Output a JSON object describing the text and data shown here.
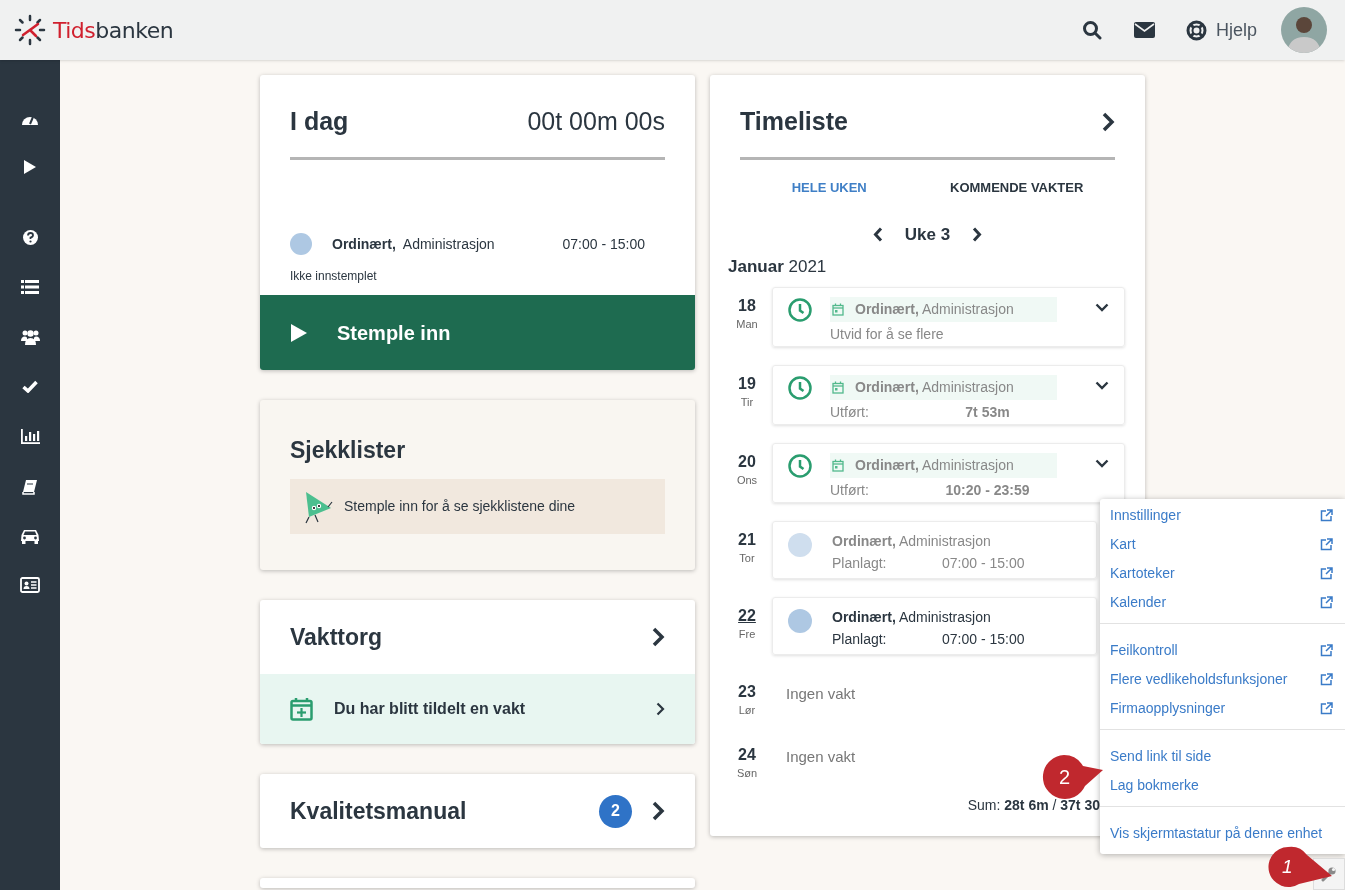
{
  "header": {
    "logo_prefix": "Tids",
    "logo_suffix": "banken",
    "help": "Hjelp"
  },
  "today": {
    "title": "I dag",
    "timer": "00t 00m 00s",
    "shift": {
      "type": "Ordinært,",
      "dept": "Administrasjon",
      "time": "07:00 - 15:00"
    },
    "status": "Ikke innstemplet",
    "button": "Stemple inn"
  },
  "checklists": {
    "title": "Sjekklister",
    "message": "Stemple inn for å se sjekklistene dine"
  },
  "shift_market": {
    "title": "Vakttorg",
    "notice": "Du har blitt tildelt en vakt"
  },
  "quality_manual": {
    "title": "Kvalitetsmanual",
    "badge": "2"
  },
  "timesheet": {
    "title": "Timeliste",
    "tabs": [
      {
        "label": "HELE UKEN",
        "selected": true
      },
      {
        "label": "KOMMENDE VAKTER",
        "selected": false
      }
    ],
    "week": "Uke 3",
    "month": "Januar",
    "year": "2021",
    "days": [
      {
        "date": "18",
        "weekday": "Man",
        "today": false,
        "entry": {
          "kind": "logged",
          "type": "Ordinært,",
          "dept": "Administrasjon",
          "note": "Utvid for å se flere"
        }
      },
      {
        "date": "19",
        "weekday": "Tir",
        "today": false,
        "entry": {
          "kind": "logged",
          "type": "Ordinært,",
          "dept": "Administrasjon",
          "label": "Utført:",
          "value": "7t 53m"
        }
      },
      {
        "date": "20",
        "weekday": "Ons",
        "today": false,
        "entry": {
          "kind": "logged",
          "type": "Ordinært,",
          "dept": "Administrasjon",
          "label": "Utført:",
          "value": "10:20 - 23:59"
        }
      },
      {
        "date": "21",
        "weekday": "Tor",
        "today": false,
        "entry": {
          "kind": "planned",
          "dimmed": true,
          "type": "Ordinært,",
          "dept": "Administrasjon",
          "label": "Planlagt:",
          "value": "07:00 - 15:00"
        }
      },
      {
        "date": "22",
        "weekday": "Fre",
        "today": true,
        "entry": {
          "kind": "planned",
          "dimmed": false,
          "type": "Ordinært,",
          "dept": "Administrasjon",
          "label": "Planlagt:",
          "value": "07:00 - 15:00"
        }
      },
      {
        "date": "23",
        "weekday": "Lør",
        "today": false,
        "empty": "Ingen vakt"
      },
      {
        "date": "24",
        "weekday": "Søn",
        "today": false,
        "empty": "Ingen vakt"
      }
    ],
    "sum": "Sum: **28t 6m** / **37t 30**"
  },
  "tools_menu": {
    "groups": [
      [
        {
          "label": "Innstillinger",
          "external": true
        },
        {
          "label": "Kart",
          "external": true
        },
        {
          "label": "Kartoteker",
          "external": true
        },
        {
          "label": "Kalender",
          "external": true
        }
      ],
      [
        {
          "label": "Feilkontroll",
          "external": true
        },
        {
          "label": "Flere vedlikeholdsfunksjoner",
          "external": true
        },
        {
          "label": "Firmaopplysninger",
          "external": true
        }
      ],
      [
        {
          "label": "Send link til side",
          "external": false
        },
        {
          "label": "Lag bokmerke",
          "external": false
        }
      ],
      [
        {
          "label": "Vis skjermtastatur på denne enhet",
          "external": false
        }
      ]
    ]
  },
  "callouts": [
    {
      "number": "1"
    },
    {
      "number": "2"
    }
  ]
}
